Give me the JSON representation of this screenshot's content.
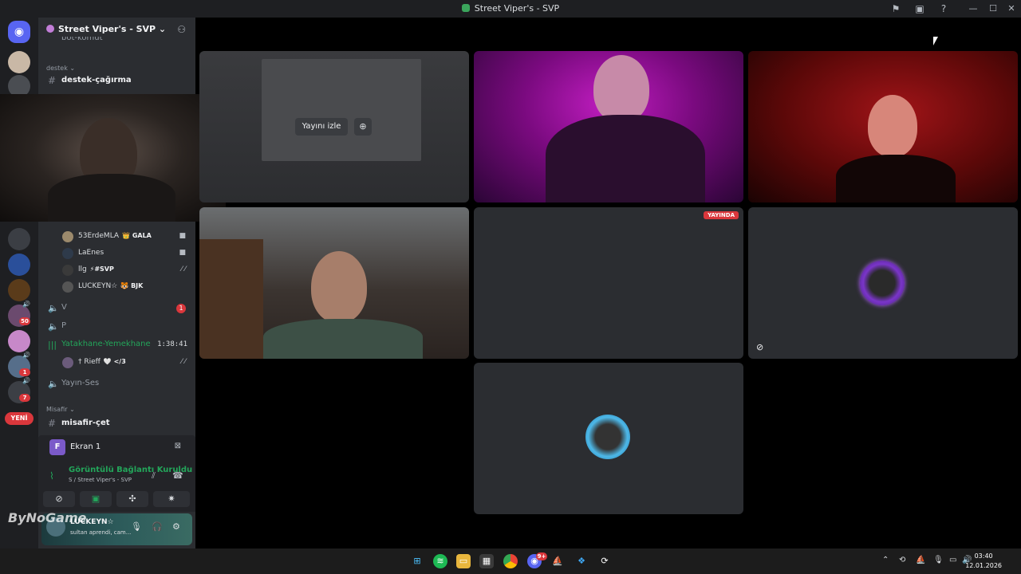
{
  "window": {
    "title": "Street Viper's - SVP"
  },
  "server": {
    "name": "Street Viper's - SVP ⌄",
    "partial_channel": "bot-komut",
    "partial_badge": "YENİ"
  },
  "channels": {
    "cat_destek": "destek ⌄",
    "destek_cagirma": "destek-çağırma",
    "voice_v": "V",
    "voice_v_badge": "1",
    "voice_p": "P",
    "yatakhane": "Yatakhane-Yemekhane",
    "yatakhane_timer": "1:38:41",
    "yayin_ses": "Yayın-Ses",
    "cat_misafir": "Misafir ⌄",
    "misafir_cet": "misafir-çet"
  },
  "members": [
    {
      "name": "53ErdeMLA",
      "tag": "👑 GALA",
      "icon": "video-icon"
    },
    {
      "name": "LaEnes",
      "tag": "",
      "icon": "video-icon"
    },
    {
      "name": "llg",
      "tag": "⚡#SVP",
      "icon": "muted-deafened-icon"
    },
    {
      "name": "LUCKEYN☆",
      "tag": "🐯 BJK",
      "icon": ""
    },
    {
      "name": "† Rieff",
      "tag": "🤍 </3",
      "icon": "muted-deafened-icon"
    }
  ],
  "rail": {
    "badges": [
      "50",
      "1",
      "7"
    ],
    "new_label": "YENİ"
  },
  "panel": {
    "screen_label": "Ekran 1",
    "screen_initial": "F",
    "connection_status": "Görüntülü Bağlantı Kuruldu",
    "connection_sub": "S / Street Viper's - SVP"
  },
  "user": {
    "name": "LUCKEYN☆",
    "status": "sultan aprendi, cam...",
    "watermark": "ByNoGame"
  },
  "stage": {
    "watch_stream": "Yayını izle",
    "live_badge": "YAYINDA"
  },
  "taskbar": {
    "time": "03:40",
    "date": "12.01.2026",
    "discord_badge": "9+"
  },
  "colors": {
    "discord_blurple": "#5865f2",
    "connected_green": "#23a55a",
    "live_red": "#da373c"
  }
}
